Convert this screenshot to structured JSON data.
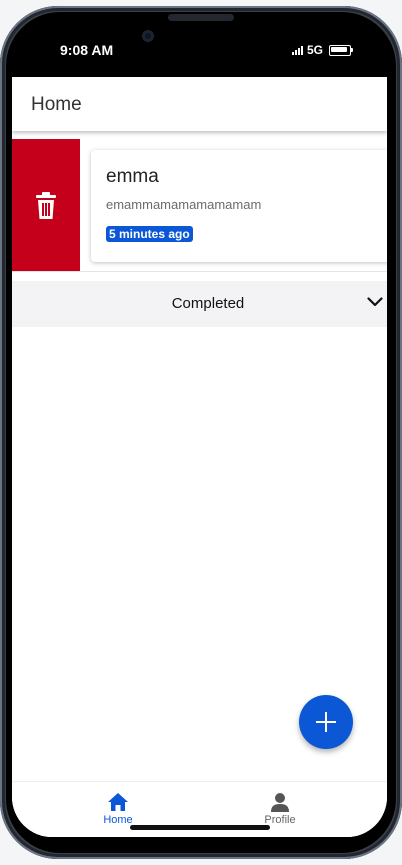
{
  "status_bar": {
    "time": "9:08 AM",
    "network": "5G"
  },
  "header": {
    "title": "Home"
  },
  "task": {
    "title": "emma",
    "description": "emammamamamamamam",
    "time_badge": "5 minutes ago",
    "delete_icon": "trash-icon"
  },
  "completed_section": {
    "label": "Completed",
    "icon": "chevron-down-icon"
  },
  "fab": {
    "icon": "plus-icon"
  },
  "bottom_nav": {
    "items": [
      {
        "label": "Home",
        "icon": "home-icon",
        "active": true
      },
      {
        "label": "Profile",
        "icon": "person-icon",
        "active": false
      }
    ]
  },
  "colors": {
    "accent": "#0b57d6",
    "delete": "#c4001a",
    "section_bg": "#f3f3f5"
  }
}
